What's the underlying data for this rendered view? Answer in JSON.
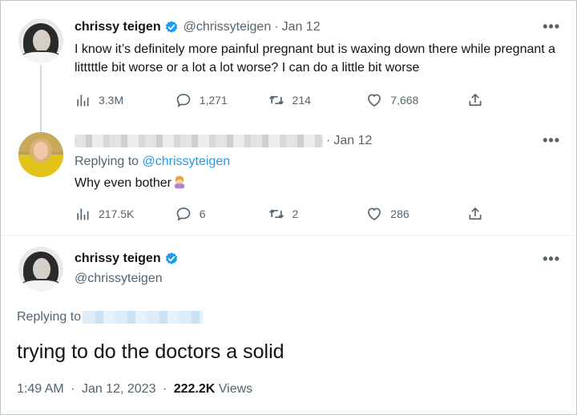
{
  "colors": {
    "accent": "#1d9bf0",
    "secondary_text": "#536471",
    "primary_text": "#0f1419",
    "verified": "#1d9bf0"
  },
  "tweet1": {
    "name": "chrissy teigen",
    "handle": "@chrissyteigen",
    "separator": "·",
    "date": "Jan 12",
    "more": "•••",
    "text": "I know it’s definitely more painful pregnant but is waxing down there while pregnant a litttttle bit worse or a lot a lot worse? I can do a little bit worse",
    "stats": {
      "views": "3.3M",
      "replies": "1,271",
      "retweets": "214",
      "likes": "7,668"
    }
  },
  "tweet2": {
    "separator": "·",
    "date": "Jan 12",
    "more": "•••",
    "replying_prefix": "Replying to",
    "replying_to": "@chrissyteigen",
    "text": "Why even bother",
    "emoji": "person-facepalming-emoji",
    "stats": {
      "views": "217.5K",
      "replies": "6",
      "retweets": "2",
      "likes": "286"
    }
  },
  "tweet3": {
    "name": "chrissy teigen",
    "handle": "@chrissyteigen",
    "more": "•••",
    "replying_prefix": "Replying to",
    "text": "trying to do the doctors a solid",
    "time": "1:49 AM",
    "separator": "·",
    "full_date": "Jan 12, 2023",
    "views_count": "222.2K",
    "views_label": "Views"
  },
  "icons": [
    "views-icon",
    "reply-icon",
    "retweet-icon",
    "like-icon",
    "share-icon",
    "verified-badge-icon",
    "more-icon"
  ]
}
